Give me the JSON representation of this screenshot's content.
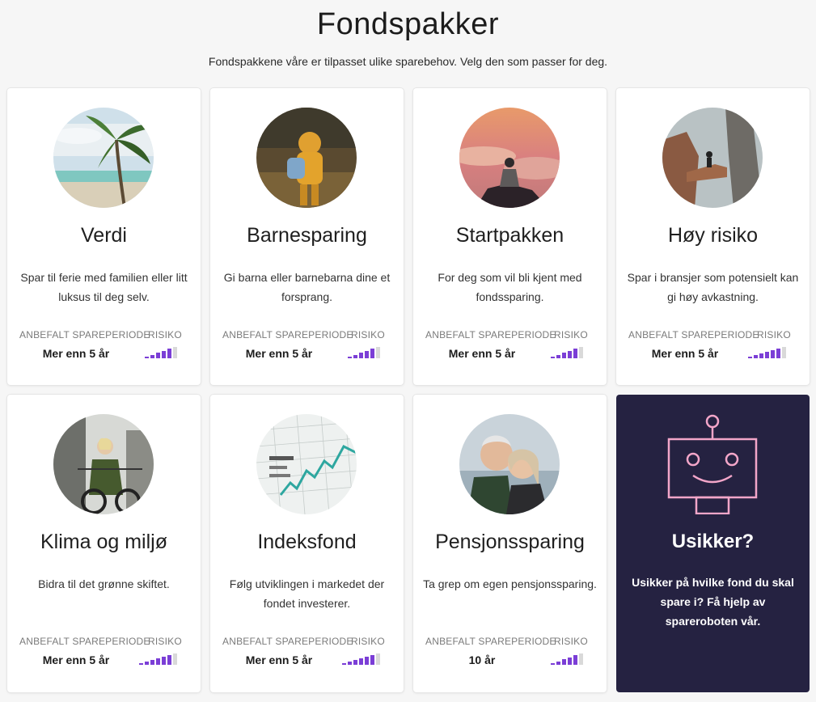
{
  "page": {
    "title": "Fondspakker",
    "subtitle": "Fondspakkene våre er tilpasset ulike sparebehov. Velg den som passer for deg."
  },
  "labels": {
    "period": "ANBEFALT SPAREPERIODE",
    "risk": "RISIKO"
  },
  "colors": {
    "accent": "#7b3ed6",
    "bar_inactive": "#d9d9d9",
    "helper_bg": "#252241",
    "robot": "#f3a6c9"
  },
  "cards": [
    {
      "title": "Verdi",
      "description": "Spar til ferie med familien eller litt luksus til deg selv.",
      "period": "Mer enn 5 år",
      "risk_level": 5,
      "risk_max": 6,
      "image_icon": "palm-beach-photo"
    },
    {
      "title": "Barnesparing",
      "description": "Gi barna eller barnebarna dine et forsprang.",
      "period": "Mer enn 5 år",
      "risk_level": 5,
      "risk_max": 6,
      "image_icon": "child-backpack-photo"
    },
    {
      "title": "Startpakken",
      "description": "For deg som vil bli kjent med fondssparing.",
      "period": "Mer enn 5 år",
      "risk_level": 5,
      "risk_max": 6,
      "image_icon": "mountain-clouds-photo"
    },
    {
      "title": "Høy risiko",
      "description": "Spar i bransjer som potensielt kan gi høy avkastning.",
      "period": "Mer enn 5 år",
      "risk_level": 6,
      "risk_max": 7,
      "image_icon": "cliff-climber-photo"
    },
    {
      "title": "Klima og miljø",
      "description": "Bidra til det grønne skiftet.",
      "period": "Mer enn 5 år",
      "risk_level": 6,
      "risk_max": 7,
      "image_icon": "woman-bicycle-photo"
    },
    {
      "title": "Indeksfond",
      "description": "Følg utviklingen i markedet der fondet investerer.",
      "period": "Mer enn 5 år",
      "risk_level": 6,
      "risk_max": 7,
      "image_icon": "stock-chart-photo"
    },
    {
      "title": "Pensjonssparing",
      "description": "Ta grep om egen pensjonssparing.",
      "period": "10 år",
      "risk_level": 5,
      "risk_max": 6,
      "image_icon": "elderly-couple-photo"
    }
  ],
  "helper": {
    "title": "Usikker?",
    "description": "Usikker på hvilke fond du skal spare i? Få hjelp av spareroboten vår.",
    "icon": "robot-icon"
  }
}
